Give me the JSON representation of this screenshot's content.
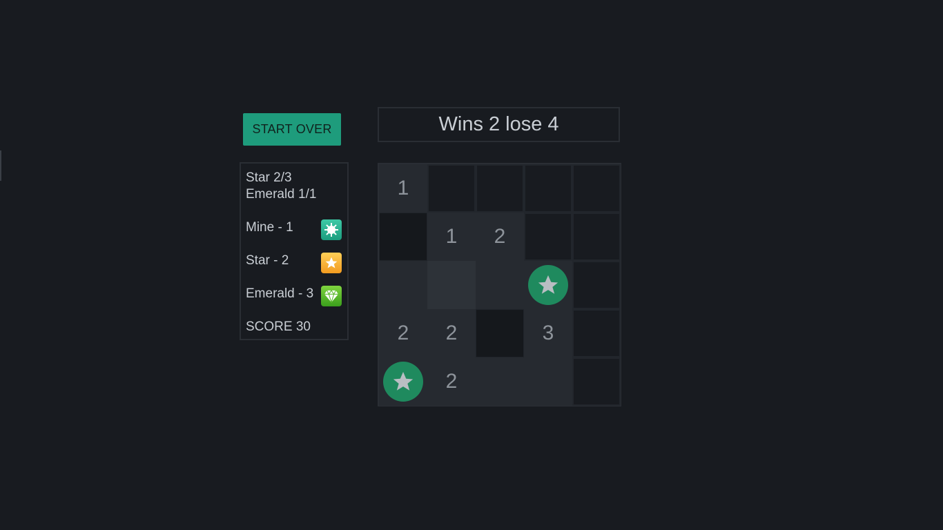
{
  "controls": {
    "start_over_label": "START OVER"
  },
  "status": {
    "wins_label": "Wins",
    "wins": "2",
    "lose_label": "lose",
    "losses": "4"
  },
  "progress": {
    "star": "Star 2/3",
    "emerald": "Emerald 1/1"
  },
  "legend": [
    {
      "label": "Mine - 1",
      "icon": "mine-icon",
      "color": "#1e9c7c"
    },
    {
      "label": "Star - 2",
      "icon": "star-icon",
      "color": "#f7b532"
    },
    {
      "label": "Emerald - 3",
      "icon": "emerald-icon",
      "color": "#5cba2e"
    }
  ],
  "score": "SCORE 30",
  "board": {
    "rows": 5,
    "cols": 5,
    "cells": [
      [
        "1",
        "",
        "",
        "",
        ""
      ],
      [
        "",
        "1",
        "2",
        "",
        ""
      ],
      [
        "",
        "",
        "",
        "star",
        ""
      ],
      [
        "2",
        "2",
        "",
        "3",
        ""
      ],
      [
        "star",
        "2",
        "",
        "",
        ""
      ]
    ],
    "states": [
      [
        "open",
        "hidden",
        "hidden",
        "hidden",
        "hidden"
      ],
      [
        "hidden-dark",
        "open",
        "open",
        "hidden",
        "hidden"
      ],
      [
        "open",
        "open-light",
        "open",
        "open",
        "hidden"
      ],
      [
        "open",
        "open",
        "hidden-dark",
        "open",
        "hidden"
      ],
      [
        "open",
        "open",
        "open",
        "open",
        "hidden"
      ]
    ],
    "colors": {
      "star_token": "#1f8a5e",
      "star_glyph": "#b9bec3",
      "number": "#8e949b"
    }
  }
}
